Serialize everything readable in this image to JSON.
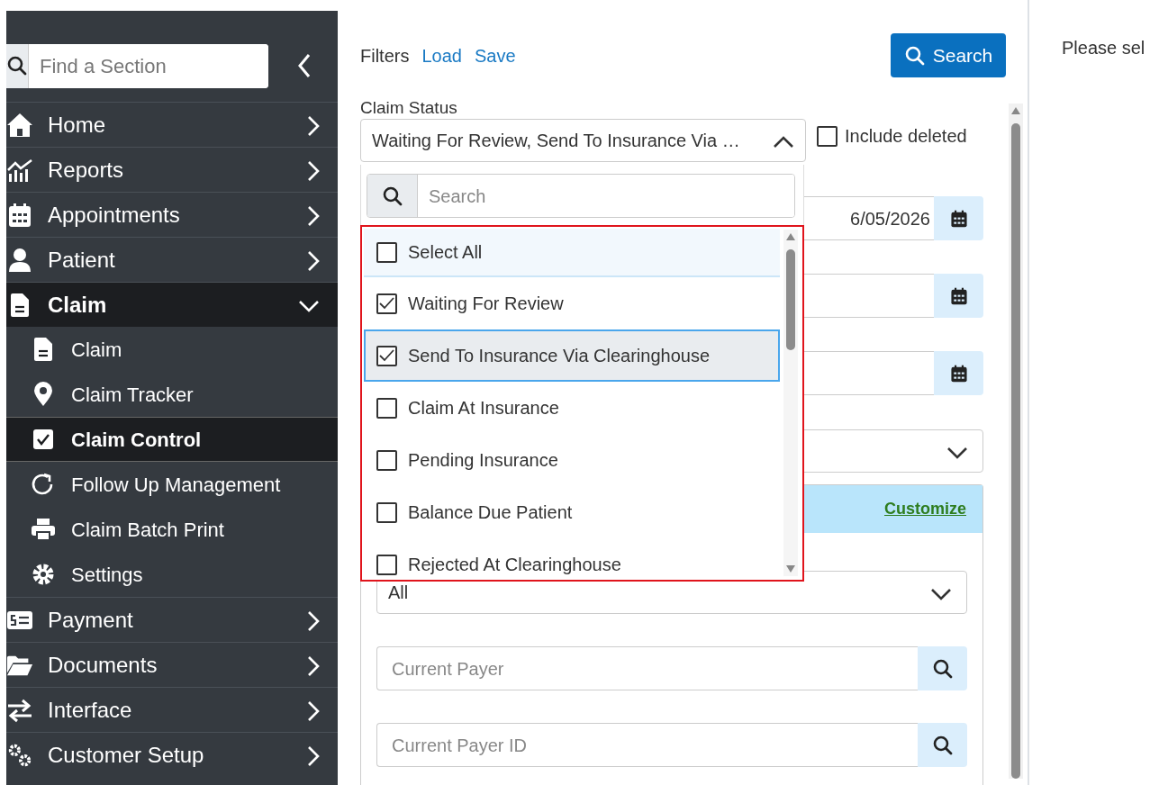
{
  "sidebar": {
    "search": {
      "placeholder": "Find a Section"
    },
    "items": [
      {
        "label": "Home",
        "expanded": false
      },
      {
        "label": "Reports",
        "expanded": false
      },
      {
        "label": "Appointments",
        "expanded": false
      },
      {
        "label": "Patient",
        "expanded": false
      },
      {
        "label": "Claim",
        "expanded": true,
        "children": [
          {
            "label": "Claim",
            "selected": false
          },
          {
            "label": "Claim Tracker",
            "selected": false
          },
          {
            "label": "Claim Control",
            "selected": true
          },
          {
            "label": "Follow Up Management",
            "selected": false
          },
          {
            "label": "Claim Batch Print",
            "selected": false
          },
          {
            "label": "Settings",
            "selected": false
          }
        ]
      },
      {
        "label": "Payment",
        "expanded": false
      },
      {
        "label": "Documents",
        "expanded": false
      },
      {
        "label": "Interface",
        "expanded": false
      },
      {
        "label": "Customer Setup",
        "expanded": false
      }
    ]
  },
  "filters": {
    "title": "Filters",
    "links": [
      "Load",
      "Save"
    ],
    "search_button": "Search"
  },
  "claim_status": {
    "label": "Claim Status",
    "value": "Waiting For Review, Send To Insurance Via …",
    "expanded": true,
    "include_deleted": {
      "label": "Include deleted",
      "checked": false
    }
  },
  "dropdown": {
    "search": {
      "placeholder": "Search"
    },
    "options": [
      {
        "kind": "select_all",
        "label": "Select All",
        "checked": false,
        "focused": false
      },
      {
        "kind": "option",
        "label": "Waiting For Review",
        "checked": true,
        "focused": false
      },
      {
        "kind": "option",
        "label": "Send To Insurance Via Clearinghouse",
        "checked": true,
        "focused": true
      },
      {
        "kind": "option",
        "label": "Claim At Insurance",
        "checked": false,
        "focused": false
      },
      {
        "kind": "option",
        "label": "Pending Insurance",
        "checked": false,
        "focused": false
      },
      {
        "kind": "option",
        "label": "Balance Due Patient",
        "checked": false,
        "focused": false
      },
      {
        "kind": "option",
        "label": "Rejected At Clearinghouse",
        "checked": false,
        "focused": false
      }
    ]
  },
  "form": {
    "date_value": "6/05/2026",
    "customize_link": "Customize",
    "select_value": "All",
    "current_payer": {
      "placeholder": "Current Payer"
    },
    "current_payer_id": {
      "placeholder": "Current Payer ID"
    }
  },
  "detail": {
    "message": "Please sel"
  }
}
